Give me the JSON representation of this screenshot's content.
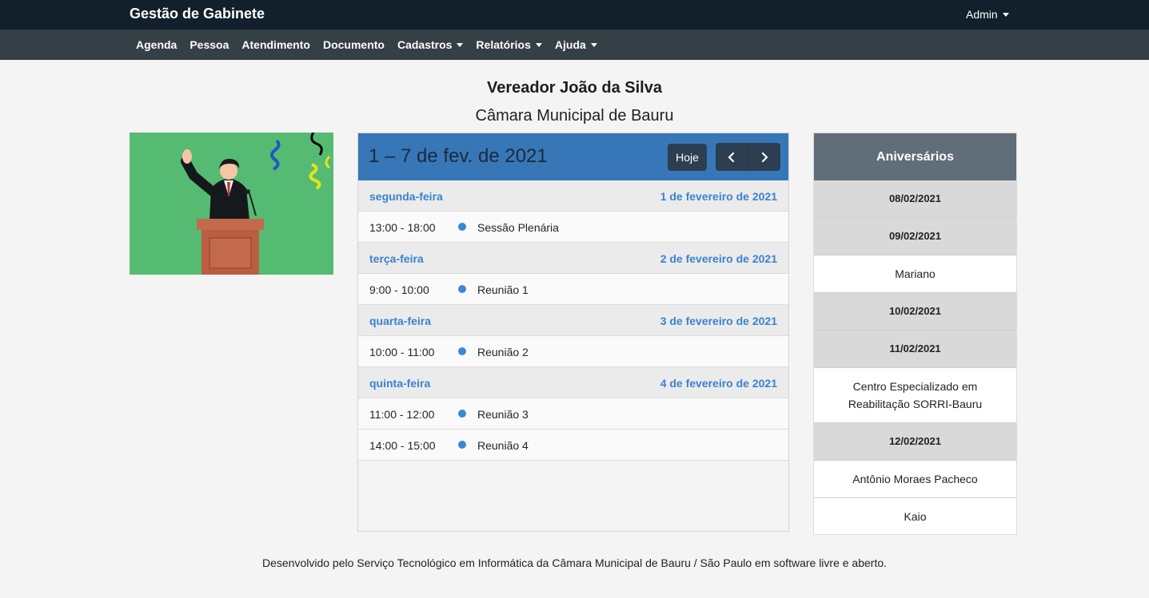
{
  "brand": "Gestão de Gabinete",
  "user_menu": "Admin",
  "nav": [
    {
      "label": "Agenda",
      "dropdown": false
    },
    {
      "label": "Pessoa",
      "dropdown": false
    },
    {
      "label": "Atendimento",
      "dropdown": false
    },
    {
      "label": "Documento",
      "dropdown": false
    },
    {
      "label": "Cadastros",
      "dropdown": true
    },
    {
      "label": "Relatórios",
      "dropdown": true
    },
    {
      "label": "Ajuda",
      "dropdown": true
    }
  ],
  "header": {
    "title": "Vereador João da Silva",
    "subtitle": "Câmara Municipal de Bauru"
  },
  "calendar": {
    "range": "1 – 7 de fev. de 2021",
    "today_label": "Hoje",
    "prev_icon": "chevron-left-icon",
    "next_icon": "chevron-right-icon",
    "rows": [
      {
        "type": "day",
        "left": "segunda-feira",
        "right": "1 de fevereiro de 2021"
      },
      {
        "type": "event",
        "time": "13:00 - 18:00",
        "title": "Sessão Plenária"
      },
      {
        "type": "day",
        "left": "terça-feira",
        "right": "2 de fevereiro de 2021"
      },
      {
        "type": "event",
        "time": "9:00 - 10:00",
        "title": "Reunião 1"
      },
      {
        "type": "day",
        "left": "quarta-feira",
        "right": "3 de fevereiro de 2021"
      },
      {
        "type": "event",
        "time": "10:00 - 11:00",
        "title": "Reunião 2"
      },
      {
        "type": "day",
        "left": "quinta-feira",
        "right": "4 de fevereiro de 2021"
      },
      {
        "type": "event",
        "time": "11:00 - 12:00",
        "title": "Reunião 3"
      },
      {
        "type": "event",
        "time": "14:00 - 15:00",
        "title": "Reunião 4"
      }
    ],
    "event_dot_color": "#3a87d8",
    "header_color": "#3777b7"
  },
  "birthdays": {
    "title": "Aniversários",
    "rows": [
      {
        "type": "date",
        "text": "08/02/2021"
      },
      {
        "type": "date",
        "text": "09/02/2021"
      },
      {
        "type": "name",
        "text": "Mariano"
      },
      {
        "type": "date",
        "text": "10/02/2021"
      },
      {
        "type": "date",
        "text": "11/02/2021"
      },
      {
        "type": "name",
        "text": "Centro Especializado em Reabilitação SORRI-Bauru"
      },
      {
        "type": "date",
        "text": "12/02/2021"
      },
      {
        "type": "name",
        "text": "Antônio Moraes Pacheco"
      },
      {
        "type": "name",
        "text": "Kaio"
      }
    ]
  },
  "footer": {
    "before": "Desenvolvido pelo Serviço Tecnológico em Informática da ",
    "link": "Câmara Municipal de Bauru",
    "after": " / São Paulo em software livre e aberto."
  }
}
